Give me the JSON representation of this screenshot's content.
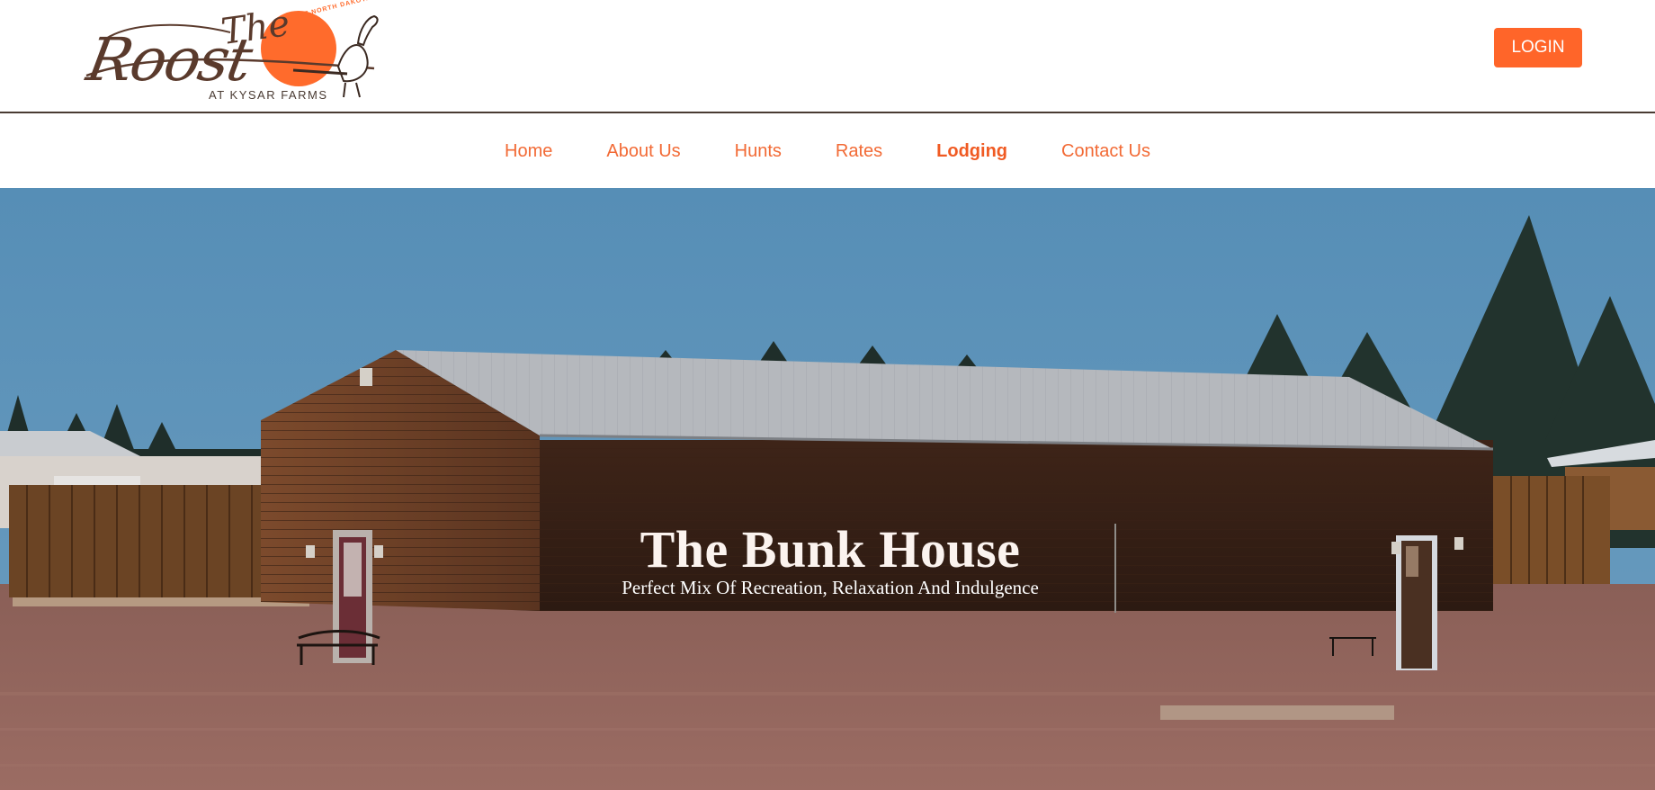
{
  "logo": {
    "title_small": "The",
    "title_large": "Roost",
    "arc_text": "REGENT NORTH DAKOTA",
    "subtitle": "At Kysar Farms",
    "accent": "#ff6b2c",
    "brown": "#5a3a2c"
  },
  "header": {
    "login_label": "LOGIN",
    "login_color": "#ff6529"
  },
  "nav": {
    "items": [
      {
        "label": "Home",
        "active": false
      },
      {
        "label": "About Us",
        "active": false
      },
      {
        "label": "Hunts",
        "active": false
      },
      {
        "label": "Rates",
        "active": false
      },
      {
        "label": "Lodging",
        "active": true
      },
      {
        "label": "Contact Us",
        "active": false
      }
    ],
    "color": "#f26a35"
  },
  "hero": {
    "title": "The Bunk House",
    "subtitle": "Perfect Mix Of Recreation, Relaxation And Indulgence"
  }
}
